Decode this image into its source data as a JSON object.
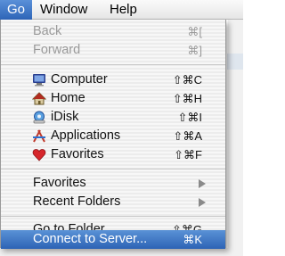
{
  "menubar": {
    "items": [
      {
        "label": "Go"
      },
      {
        "label": "Window"
      },
      {
        "label": "Help"
      }
    ]
  },
  "menu": {
    "back": {
      "label": "Back",
      "shortcut": "⌘["
    },
    "forward": {
      "label": "Forward",
      "shortcut": "⌘]"
    },
    "computer": {
      "label": "Computer",
      "shortcut": "⇧⌘C",
      "icon": "computer-icon"
    },
    "home": {
      "label": "Home",
      "shortcut": "⇧⌘H",
      "icon": "home-icon"
    },
    "idisk": {
      "label": "iDisk",
      "shortcut": "⇧⌘I",
      "icon": "idisk-icon"
    },
    "applications": {
      "label": "Applications",
      "shortcut": "⇧⌘A",
      "icon": "applications-icon"
    },
    "favorites_item": {
      "label": "Favorites",
      "shortcut": "⇧⌘F",
      "icon": "heart-icon"
    },
    "favorites_sub": {
      "label": "Favorites"
    },
    "recent_folders": {
      "label": "Recent Folders"
    },
    "go_to_folder": {
      "label": "Go to Folder...",
      "shortcut": "⇧⌘G"
    },
    "connect_to_server": {
      "label": "Connect to Server...",
      "shortcut": "⌘K"
    }
  },
  "colors": {
    "selection": "#3f78c4",
    "disabled_text": "#9a9a9a"
  }
}
